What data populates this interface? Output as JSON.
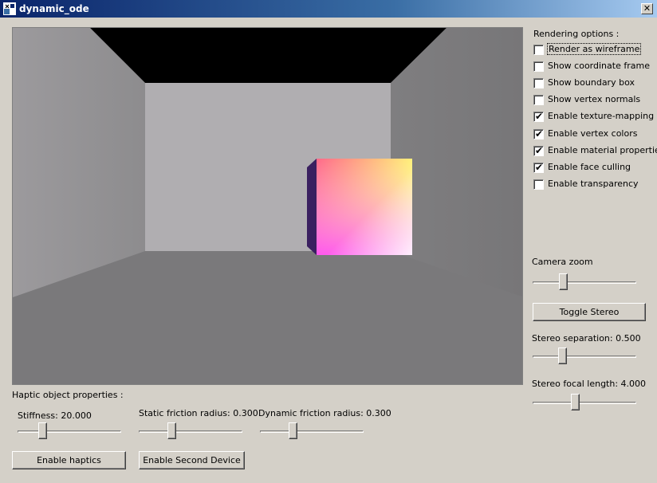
{
  "window": {
    "title": "dynamic_ode",
    "close_label": "✕"
  },
  "rendering": {
    "heading": "Rendering options :",
    "options": [
      {
        "label": "Render as wireframe",
        "checked": false
      },
      {
        "label": "Show coordinate frame",
        "checked": false
      },
      {
        "label": "Show boundary box",
        "checked": false
      },
      {
        "label": "Show vertex normals",
        "checked": false
      },
      {
        "label": "Enable texture-mapping",
        "checked": true
      },
      {
        "label": "Enable vertex colors",
        "checked": true
      },
      {
        "label": "Enable material properties",
        "checked": true
      },
      {
        "label": "Enable face culling",
        "checked": true
      },
      {
        "label": "Enable transparency",
        "checked": false
      }
    ]
  },
  "camera": {
    "zoom_label": "Camera zoom",
    "zoom_value": 0.28,
    "toggle_stereo": "Toggle Stereo",
    "stereo_separation_label": "Stereo separation: 0.500",
    "stereo_separation_value": 0.27,
    "stereo_focal_label": "Stereo focal length: 4.000",
    "stereo_focal_value": 0.4
  },
  "haptic": {
    "heading": "Haptic object properties :",
    "stiffness_label": "Stiffness: 20.000",
    "stiffness_value": 0.22,
    "static_friction_label": "Static friction radius: 0.300",
    "static_friction_value": 0.3,
    "dynamic_friction_label": "Dynamic friction radius: 0.300",
    "dynamic_friction_value": 0.3,
    "enable_haptics": "Enable haptics",
    "enable_second_device": "Enable Second Device"
  }
}
